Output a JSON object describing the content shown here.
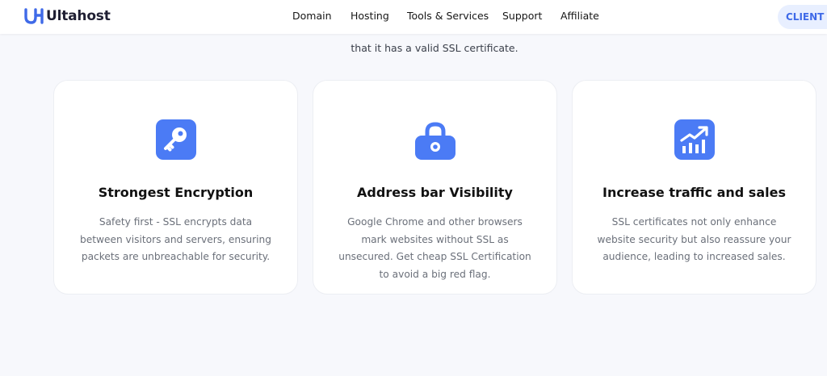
{
  "header": {
    "logo_text": "Ultahost",
    "nav": [
      "Domain",
      "Hosting",
      "Tools & Services",
      "Support",
      "Affiliate"
    ],
    "client_button": "CLIENT AREA"
  },
  "intro": {
    "subtitle": "that it has a valid SSL certificate."
  },
  "features": [
    {
      "icon": "key-icon",
      "title": "Strongest Encryption",
      "description": "Safety first - SSL encrypts data between visitors and servers, ensuring packets are unbreachable for security."
    },
    {
      "icon": "lock-icon",
      "title": "Address bar Visibility",
      "description": "Google Chrome and other browsers mark websites without SSL as unsecured. Get cheap SSL Certification to avoid a big red flag."
    },
    {
      "icon": "chart-growth-icon",
      "title": "Increase traffic and sales",
      "description": "SSL certificates not only enhance website security but also reassure your audience, leading to increased sales."
    }
  ],
  "colors": {
    "accent": "#3f6ae8",
    "icon_bg": "#4b7bf5",
    "page_bg": "#f7f8fc"
  }
}
